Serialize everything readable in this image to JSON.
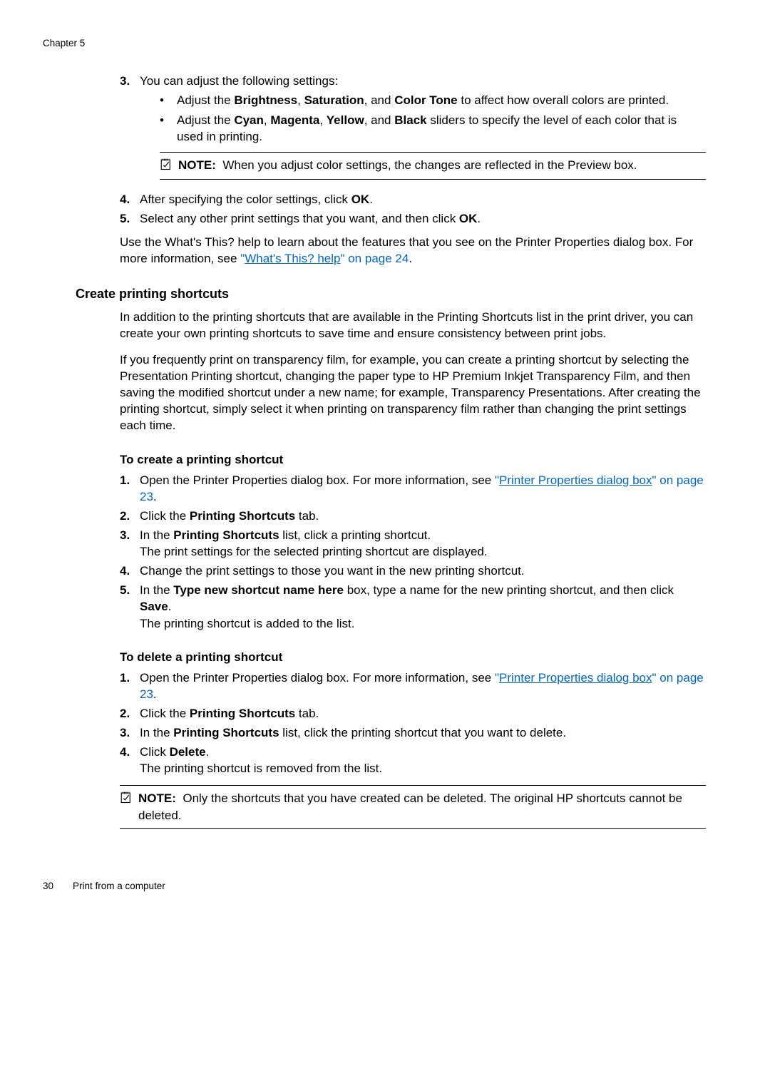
{
  "chapter": "Chapter 5",
  "step3": {
    "num": "3.",
    "lead": "You can adjust the following settings:",
    "b1_prefix": "Adjust the ",
    "b1_w1": "Brightness",
    "b1_sep1": ", ",
    "b1_w2": "Saturation",
    "b1_sep2": ", and ",
    "b1_w3": "Color Tone",
    "b1_suffix": " to affect how overall colors are printed.",
    "b2_prefix": "Adjust the ",
    "b2_w1": "Cyan",
    "b2_sep1": ", ",
    "b2_w2": "Magenta",
    "b2_sep2": ", ",
    "b2_w3": "Yellow",
    "b2_sep3": ", and ",
    "b2_w4": "Black",
    "b2_suffix": " sliders to specify the level of each color that is used in printing.",
    "note_label": "NOTE:",
    "note_text": "When you adjust color settings, the changes are reflected in the Preview box."
  },
  "step4": {
    "num": "4.",
    "prefix": "After specifying the color settings, click ",
    "btn": "OK",
    "suffix": "."
  },
  "step5": {
    "num": "5.",
    "prefix": "Select any other print settings that you want, and then click ",
    "btn": "OK",
    "suffix": "."
  },
  "post_para": {
    "t1": "Use the What's This? help to learn about the features that you see on the Printer Properties dialog box. For more information, see ",
    "link_q": "\"",
    "link_text": "What's This? help",
    "link_end": "\" on page 24",
    "tail": "."
  },
  "section_title": "Create printing shortcuts",
  "para1": "In addition to the printing shortcuts that are available in the Printing Shortcuts list in the print driver, you can create your own printing shortcuts to save time and ensure consistency between print jobs.",
  "para2": "If you frequently print on transparency film, for example, you can create a printing shortcut by selecting the Presentation Printing shortcut, changing the paper type to HP Premium Inkjet Transparency Film, and then saving the modified shortcut under a new name; for example, Transparency Presentations. After creating the printing shortcut, simply select it when printing on transparency film rather than changing the print settings each time.",
  "create_h": "To create a printing shortcut",
  "c1": {
    "num": "1.",
    "t1": "Open the Printer Properties dialog box. For more information, see ",
    "link_q": "\"",
    "link_text": "Printer Properties dialog box",
    "link_end": "\" on page 23",
    "tail": "."
  },
  "c2": {
    "num": "2.",
    "t1": "Click the ",
    "b": "Printing Shortcuts",
    "t2": " tab."
  },
  "c3": {
    "num": "3.",
    "t1": "In the ",
    "b": "Printing Shortcuts",
    "t2": " list, click a printing shortcut.",
    "line2": "The print settings for the selected printing shortcut are displayed."
  },
  "c4": {
    "num": "4.",
    "t": "Change the print settings to those you want in the new printing shortcut."
  },
  "c5": {
    "num": "5.",
    "t1": "In the ",
    "b1": "Type new shortcut name here",
    "t2": " box, type a name for the new printing shortcut, and then click ",
    "b2": "Save",
    "t3": ".",
    "line2": "The printing shortcut is added to the list."
  },
  "delete_h": "To delete a printing shortcut",
  "d1": {
    "num": "1.",
    "t1": "Open the Printer Properties dialog box. For more information, see ",
    "link_q": "\"",
    "link_text": "Printer Properties dialog box",
    "link_end": "\" on page 23",
    "tail": "."
  },
  "d2": {
    "num": "2.",
    "t1": "Click the ",
    "b": "Printing Shortcuts",
    "t2": " tab."
  },
  "d3": {
    "num": "3.",
    "t1": "In the ",
    "b": "Printing Shortcuts",
    "t2": " list, click the printing shortcut that you want to delete."
  },
  "d4": {
    "num": "4.",
    "t1": "Click ",
    "b": "Delete",
    "t2": ".",
    "line2": "The printing shortcut is removed from the list."
  },
  "final_note": {
    "label": "NOTE:",
    "text": "Only the shortcuts that you have created can be deleted. The original HP shortcuts cannot be deleted."
  },
  "footer_page": "30",
  "footer_text": "Print from a computer"
}
